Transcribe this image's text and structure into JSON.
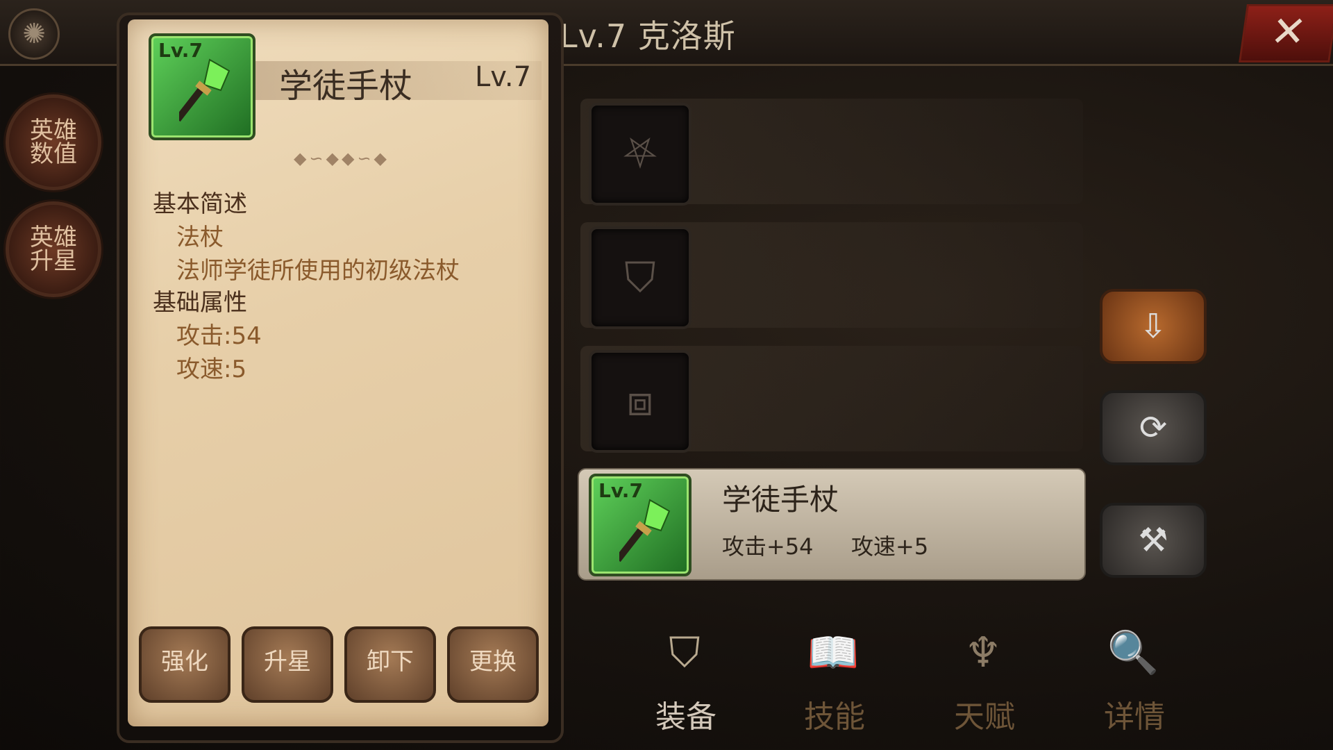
{
  "header": {
    "hero_title": "Lv.7 克洛斯",
    "close_symbol": "✕"
  },
  "side_buttons": [
    {
      "label": "英雄数值"
    },
    {
      "label": "英雄升星"
    }
  ],
  "item_panel": {
    "icon_level": "Lv.7",
    "name": "学徒手杖",
    "level": "Lv.7",
    "divider": "◆∽◆◆∽◆",
    "sections": {
      "basic_desc_title": "基本简述",
      "type": "法杖",
      "description": "法师学徒所使用的初级法杖",
      "basic_attr_title": "基础属性",
      "attack": "攻击:54",
      "attack_speed": "攻速:5"
    },
    "actions": [
      "强化",
      "升星",
      "卸下",
      "更换"
    ]
  },
  "slots": [
    {
      "icon": "amulet-icon",
      "glyph": "⛧"
    },
    {
      "icon": "armor-icon",
      "glyph": "⛉"
    },
    {
      "icon": "boots-icon",
      "glyph": "⧈"
    }
  ],
  "equipped": {
    "icon_level": "Lv.7",
    "name": "学徒手杖",
    "stat1": "攻击+54",
    "stat2": "攻速+5"
  },
  "right_buttons": [
    {
      "icon": "unequip-all-icon",
      "glyph": "⇩"
    },
    {
      "icon": "auto-equip-icon",
      "glyph": "⟳"
    },
    {
      "icon": "forge-icon",
      "glyph": "⚒"
    }
  ],
  "tabs": [
    {
      "label": "装备",
      "icon": "armor-tab-icon",
      "glyph": "⛉",
      "active": true
    },
    {
      "label": "技能",
      "icon": "skill-book-icon",
      "glyph": "📖",
      "active": false
    },
    {
      "label": "天赋",
      "icon": "talent-icon",
      "glyph": "♆",
      "active": false
    },
    {
      "label": "详情",
      "icon": "detail-icon",
      "glyph": "🔍",
      "active": false
    }
  ],
  "colors": {
    "parchment": "#e7cfa9",
    "item_green": "#5fd15a",
    "close_red": "#8d2018"
  }
}
